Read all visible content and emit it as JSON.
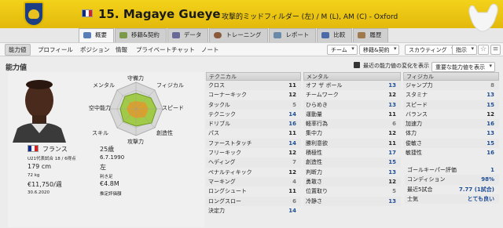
{
  "header": {
    "player_number": "15.",
    "player_name": "Magaye Gueye",
    "position_text": "攻撃的ミッドフィルダー (左) / M (L), AM (C) - Oxford",
    "accent_color": "#e5be10"
  },
  "tabs": [
    {
      "label": "概要",
      "icon": "overview-icon",
      "active": true
    },
    {
      "label": "移籍&契約",
      "icon": "transfer-icon",
      "active": false
    },
    {
      "label": "データ",
      "icon": "stats-icon",
      "active": false
    },
    {
      "label": "トレーニング",
      "icon": "training-icon",
      "active": false
    },
    {
      "label": "レポート",
      "icon": "report-icon",
      "active": false
    },
    {
      "label": "比較",
      "icon": "compare-icon",
      "active": false
    },
    {
      "label": "履歴",
      "icon": "history-icon",
      "active": false
    }
  ],
  "toolbar": {
    "items": [
      "能力値",
      "プロフィール",
      "ポジション",
      "情報",
      "プライベートチャット",
      "ノート"
    ],
    "dropdowns": [
      "チーム",
      "移籍&契約",
      "スカウティング",
      "指示"
    ],
    "checkbox_label": "最近の能力値の変化を表示",
    "attr_dropdown": "重要な能力値を表示"
  },
  "section_title": "能力値",
  "radar": {
    "labels": [
      "守備力",
      "フィジカル",
      "スピード",
      "創造性",
      "攻撃力",
      "スキル",
      "空中能力",
      "メンタル"
    ]
  },
  "profile": {
    "nationality": "フランス",
    "age": "25歳",
    "u21_label": "U21代表試合 18 / 6得点",
    "birth_date": "6.7.1990",
    "height": "179 cm",
    "foot": "左",
    "weight": "72 kg",
    "foot_label": "利き足",
    "wage": "€11,750/週",
    "value": "€4.8M",
    "contract_end": "30.6.2020",
    "value_label": "推定評価額"
  },
  "technical": {
    "title": "テクニカル",
    "rows": [
      {
        "name": "クロス",
        "value": "11"
      },
      {
        "name": "コーナーキック",
        "value": "12"
      },
      {
        "name": "タックル",
        "value": "5"
      },
      {
        "name": "テクニック",
        "value": "14"
      },
      {
        "name": "ドリブル",
        "value": "16"
      },
      {
        "name": "パス",
        "value": "11"
      },
      {
        "name": "ファーストタッチ",
        "value": "14"
      },
      {
        "name": "フリーキック",
        "value": "12"
      },
      {
        "name": "ヘディング",
        "value": "7"
      },
      {
        "name": "ペナルティキック",
        "value": "12"
      },
      {
        "name": "マーキング",
        "value": "4"
      },
      {
        "name": "ロングシュート",
        "value": "11"
      },
      {
        "name": "ロングスロー",
        "value": "6"
      },
      {
        "name": "決定力",
        "value": "14"
      }
    ]
  },
  "mental": {
    "title": "メンタル",
    "rows": [
      {
        "name": "オフ ザ ボール",
        "value": "13"
      },
      {
        "name": "チームワーク",
        "value": "12"
      },
      {
        "name": "ひらめき",
        "value": "13"
      },
      {
        "name": "運動量",
        "value": "11"
      },
      {
        "name": "軽率行為",
        "value": "6"
      },
      {
        "name": "集中力",
        "value": "12"
      },
      {
        "name": "勝利意欲",
        "value": "11"
      },
      {
        "name": "積極性",
        "value": "17"
      },
      {
        "name": "創造性",
        "value": "15"
      },
      {
        "name": "判断力",
        "value": "13"
      },
      {
        "name": "勇敢さ",
        "value": "12"
      },
      {
        "name": "位置取り",
        "value": "5"
      },
      {
        "name": "冷静さ",
        "value": "13"
      }
    ]
  },
  "physical": {
    "title": "フィジカル",
    "rows": [
      {
        "name": "ジャンプ力",
        "value": "8"
      },
      {
        "name": "スタミナ",
        "value": "13"
      },
      {
        "name": "スピード",
        "value": "15"
      },
      {
        "name": "バランス",
        "value": "12"
      },
      {
        "name": "加速力",
        "value": "16"
      },
      {
        "name": "体力",
        "value": "13"
      },
      {
        "name": "俊敏さ",
        "value": "15"
      },
      {
        "name": "敏捷性",
        "value": "16"
      }
    ]
  },
  "status": {
    "rows": [
      {
        "name": "ゴールキーパー評価",
        "value": "1"
      },
      {
        "name": "コンディション",
        "value": "98%"
      },
      {
        "name": "最近5試合",
        "value": "7.77 (1試合)"
      },
      {
        "name": "士気",
        "value": "とても良い"
      }
    ]
  }
}
